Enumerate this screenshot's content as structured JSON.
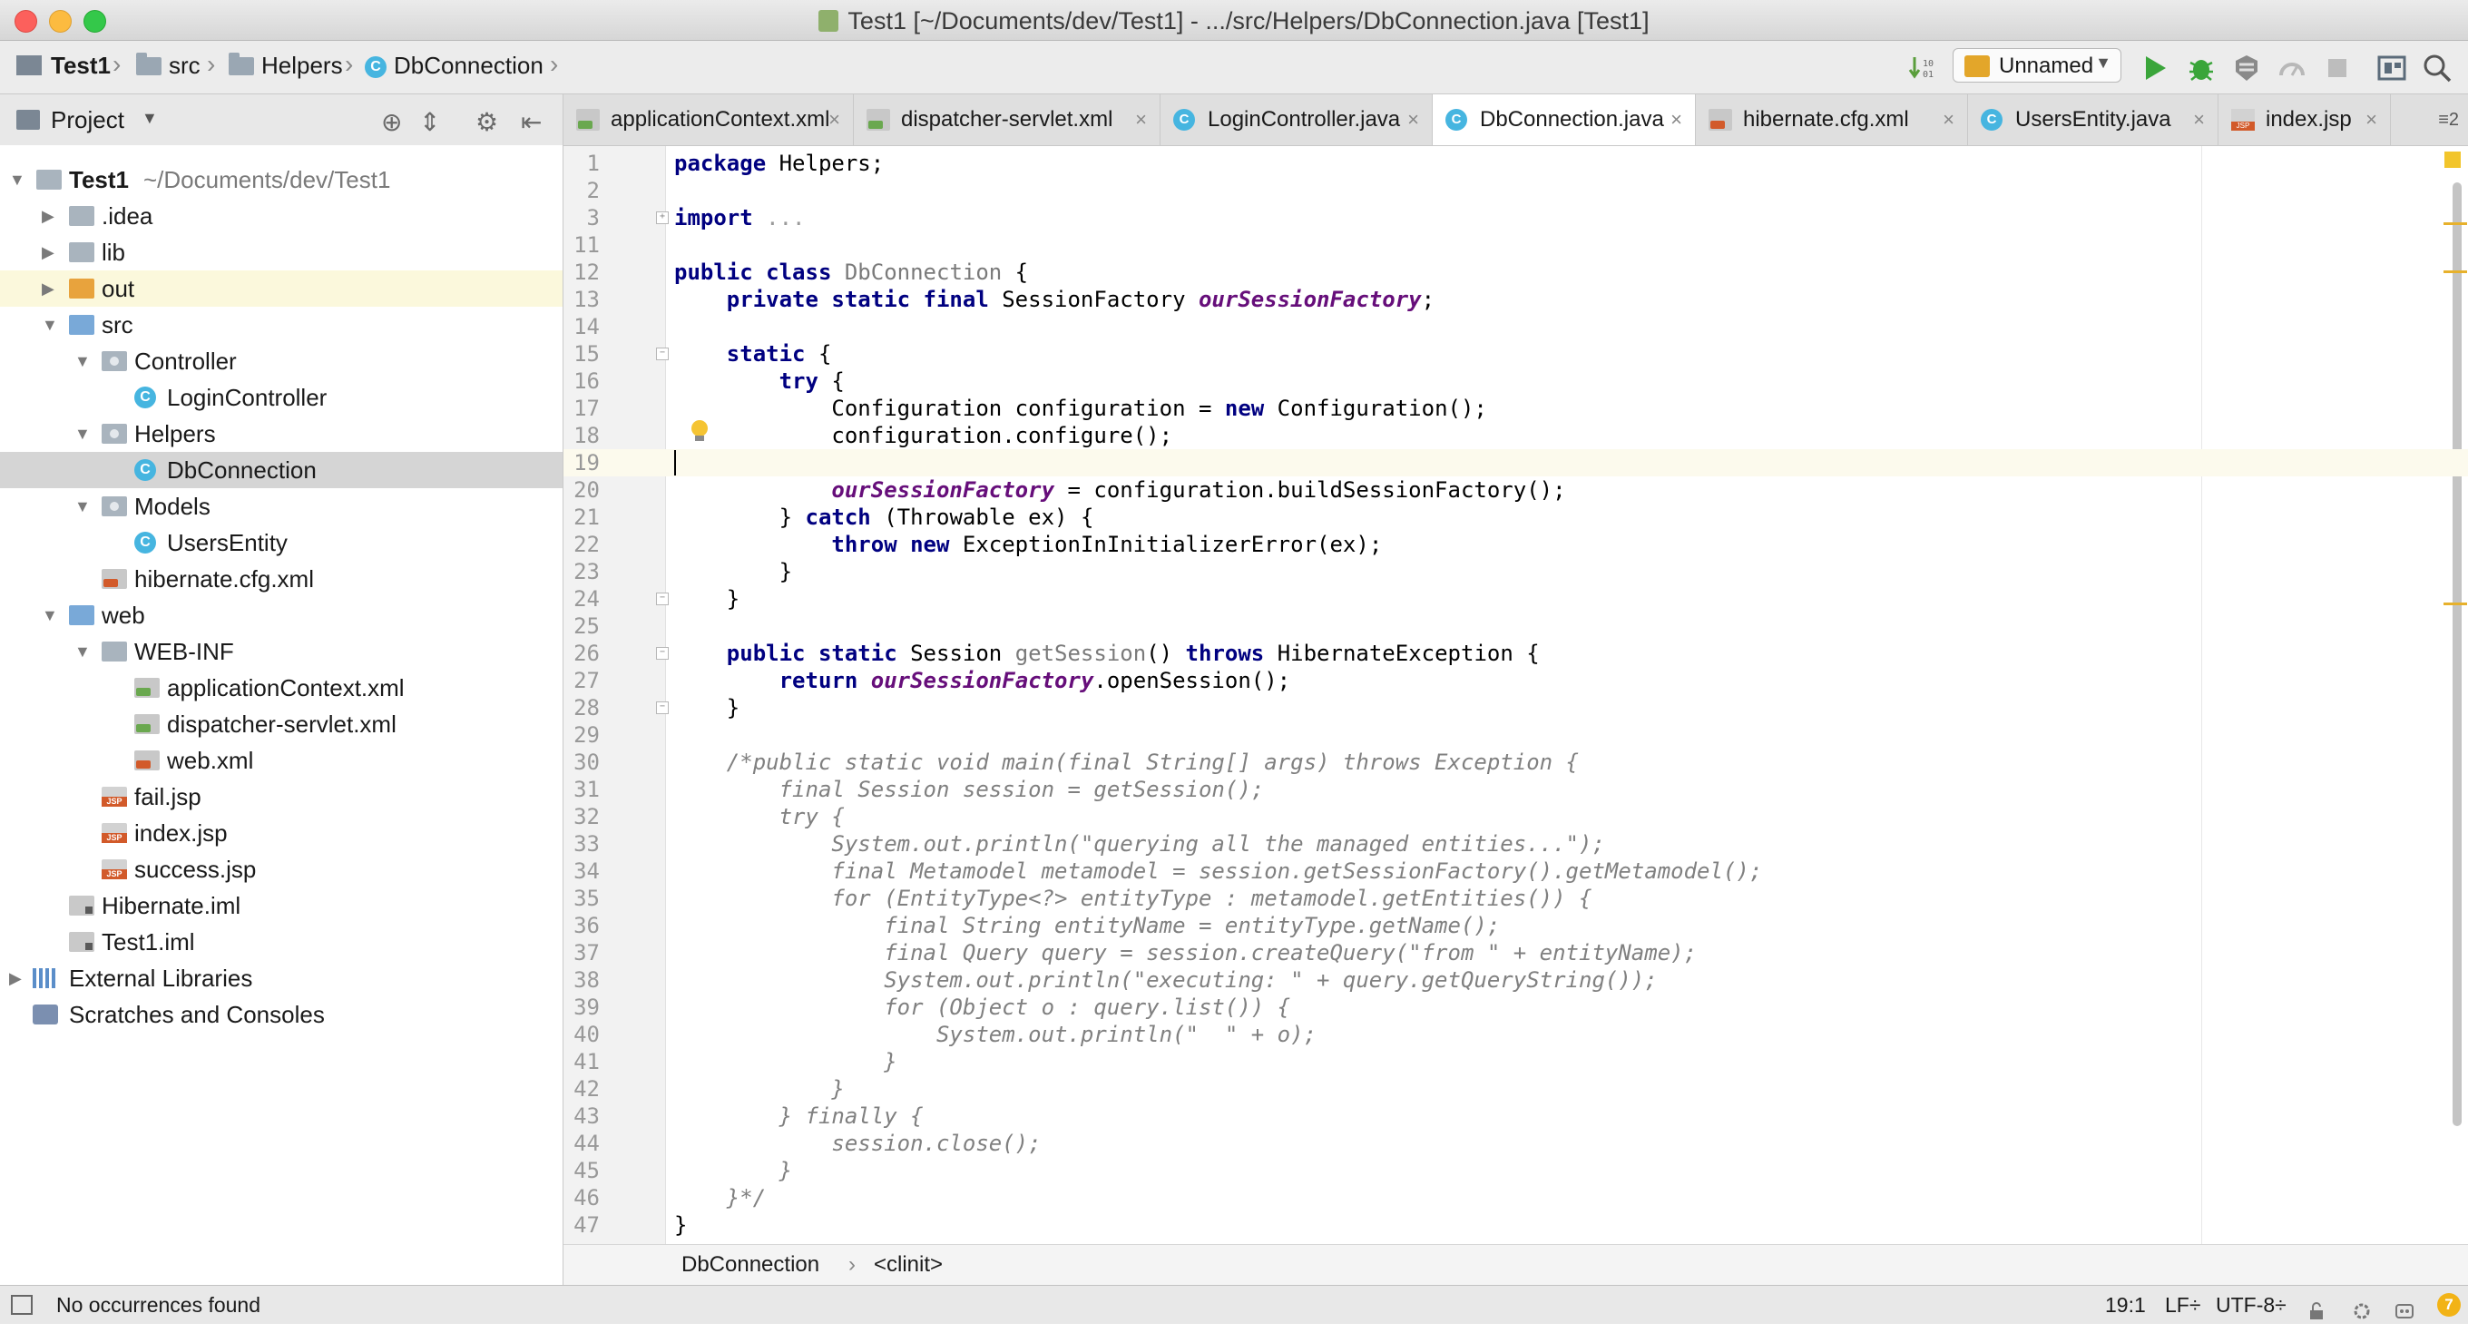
{
  "window": {
    "title": "Test1 [~/Documents/dev/Test1] - .../src/Helpers/DbConnection.java [Test1]"
  },
  "navbar": {
    "breadcrumb": [
      "Test1",
      "src",
      "Helpers",
      "DbConnection"
    ],
    "run_config": "Unnamed"
  },
  "project_panel": {
    "title": "Project",
    "tree": [
      {
        "label": "Test1",
        "hint": "~/Documents/dev/Test1",
        "icon": "project-folder-icon",
        "depth": 0,
        "expanded": true
      },
      {
        "label": ".idea",
        "icon": "folder-icon",
        "depth": 1,
        "expanded": false
      },
      {
        "label": "lib",
        "icon": "folder-icon",
        "depth": 1,
        "expanded": false
      },
      {
        "label": "out",
        "icon": "excluded-folder-icon",
        "depth": 1,
        "expanded": false,
        "excluded": true
      },
      {
        "label": "src",
        "icon": "source-folder-icon",
        "depth": 1,
        "expanded": true
      },
      {
        "label": "Controller",
        "icon": "package-icon",
        "depth": 2,
        "expanded": true
      },
      {
        "label": "LoginController",
        "icon": "java-class-icon",
        "depth": 3
      },
      {
        "label": "Helpers",
        "icon": "package-icon",
        "depth": 2,
        "expanded": true
      },
      {
        "label": "DbConnection",
        "icon": "java-class-icon",
        "depth": 3,
        "selected": true
      },
      {
        "label": "Models",
        "icon": "package-icon",
        "depth": 2,
        "expanded": true
      },
      {
        "label": "UsersEntity",
        "icon": "java-class-icon",
        "depth": 3
      },
      {
        "label": "hibernate.cfg.xml",
        "icon": "xml-file-icon",
        "depth": 2
      },
      {
        "label": "web",
        "icon": "web-folder-icon",
        "depth": 1,
        "expanded": true
      },
      {
        "label": "WEB-INF",
        "icon": "folder-icon",
        "depth": 2,
        "expanded": true
      },
      {
        "label": "applicationContext.xml",
        "icon": "spring-xml-icon",
        "depth": 3
      },
      {
        "label": "dispatcher-servlet.xml",
        "icon": "spring-xml-icon",
        "depth": 3
      },
      {
        "label": "web.xml",
        "icon": "web-xml-icon",
        "depth": 3
      },
      {
        "label": "fail.jsp",
        "icon": "jsp-file-icon",
        "depth": 2
      },
      {
        "label": "index.jsp",
        "icon": "jsp-file-icon",
        "depth": 2
      },
      {
        "label": "success.jsp",
        "icon": "jsp-file-icon",
        "depth": 2
      },
      {
        "label": "Hibernate.iml",
        "icon": "iml-file-icon",
        "depth": 1
      },
      {
        "label": "Test1.iml",
        "icon": "iml-file-icon",
        "depth": 1
      },
      {
        "label": "External Libraries",
        "icon": "libraries-icon",
        "depth": 0,
        "expanded": false
      },
      {
        "label": "Scratches and Consoles",
        "icon": "scratches-icon",
        "depth": 0
      }
    ]
  },
  "tabs": [
    {
      "label": "applicationContext.xml",
      "icon": "spring-xml-icon"
    },
    {
      "label": "dispatcher-servlet.xml",
      "icon": "spring-xml-icon"
    },
    {
      "label": "LoginController.java",
      "icon": "java-class-icon"
    },
    {
      "label": "DbConnection.java",
      "icon": "java-class-icon",
      "active": true
    },
    {
      "label": "hibernate.cfg.xml",
      "icon": "xml-file-icon"
    },
    {
      "label": "UsersEntity.java",
      "icon": "java-class-icon"
    },
    {
      "label": "index.jsp",
      "icon": "jsp-file-icon"
    }
  ],
  "tabs_overflow": "2",
  "editor": {
    "current_line": "19",
    "lines": [
      {
        "n": "1",
        "segs": [
          [
            "kw",
            "package"
          ],
          [
            "p",
            " Helpers;"
          ]
        ]
      },
      {
        "n": "2",
        "segs": []
      },
      {
        "n": "3",
        "segs": [
          [
            "kw",
            "import"
          ],
          [
            "p",
            " "
          ],
          [
            "fold",
            "..."
          ]
        ]
      },
      {
        "n": "11",
        "segs": []
      },
      {
        "n": "12",
        "segs": [
          [
            "kw",
            "public class"
          ],
          [
            "p",
            " "
          ],
          [
            "mname",
            "DbConnection"
          ],
          [
            "p",
            " {"
          ]
        ]
      },
      {
        "n": "13",
        "segs": [
          [
            "p",
            "    "
          ],
          [
            "kw",
            "private static final"
          ],
          [
            "p",
            " SessionFactory "
          ],
          [
            "fld",
            "ourSessionFactory"
          ],
          [
            "p",
            ";"
          ]
        ]
      },
      {
        "n": "14",
        "segs": []
      },
      {
        "n": "15",
        "segs": [
          [
            "p",
            "    "
          ],
          [
            "kw",
            "static"
          ],
          [
            "p",
            " {"
          ]
        ]
      },
      {
        "n": "16",
        "segs": [
          [
            "p",
            "        "
          ],
          [
            "kw",
            "try"
          ],
          [
            "p",
            " {"
          ]
        ]
      },
      {
        "n": "17",
        "segs": [
          [
            "p",
            "            Configuration configuration = "
          ],
          [
            "kw",
            "new"
          ],
          [
            "p",
            " Configuration();"
          ]
        ]
      },
      {
        "n": "18",
        "segs": [
          [
            "p",
            "            configuration.configure();"
          ]
        ]
      },
      {
        "n": "19",
        "segs": []
      },
      {
        "n": "20",
        "segs": [
          [
            "p",
            "            "
          ],
          [
            "fld",
            "ourSessionFactory"
          ],
          [
            "p",
            " = configuration.buildSessionFactory();"
          ]
        ]
      },
      {
        "n": "21",
        "segs": [
          [
            "p",
            "        } "
          ],
          [
            "kw",
            "catch"
          ],
          [
            "p",
            " (Throwable ex) {"
          ]
        ]
      },
      {
        "n": "22",
        "segs": [
          [
            "p",
            "            "
          ],
          [
            "kw",
            "throw new"
          ],
          [
            "p",
            " ExceptionInInitializerError(ex);"
          ]
        ]
      },
      {
        "n": "23",
        "segs": [
          [
            "p",
            "        }"
          ]
        ]
      },
      {
        "n": "24",
        "segs": [
          [
            "p",
            "    }"
          ]
        ]
      },
      {
        "n": "25",
        "segs": []
      },
      {
        "n": "26",
        "segs": [
          [
            "p",
            "    "
          ],
          [
            "kw",
            "public static"
          ],
          [
            "p",
            " Session "
          ],
          [
            "mname",
            "getSession"
          ],
          [
            "p",
            "() "
          ],
          [
            "kw",
            "throws"
          ],
          [
            "p",
            " HibernateException {"
          ]
        ]
      },
      {
        "n": "27",
        "segs": [
          [
            "p",
            "        "
          ],
          [
            "kw",
            "return"
          ],
          [
            "p",
            " "
          ],
          [
            "fld",
            "ourSessionFactory"
          ],
          [
            "p",
            ".openSession();"
          ]
        ]
      },
      {
        "n": "28",
        "segs": [
          [
            "p",
            "    }"
          ]
        ]
      },
      {
        "n": "29",
        "segs": []
      },
      {
        "n": "30",
        "segs": [
          [
            "p",
            "    "
          ],
          [
            "cmt",
            "/*public static void main(final String[] args) throws Exception {"
          ]
        ]
      },
      {
        "n": "31",
        "segs": [
          [
            "cmt",
            "        final Session session = getSession();"
          ]
        ]
      },
      {
        "n": "32",
        "segs": [
          [
            "cmt",
            "        try {"
          ]
        ]
      },
      {
        "n": "33",
        "segs": [
          [
            "cmt",
            "            System.out.println(\"querying all the managed entities...\");"
          ]
        ]
      },
      {
        "n": "34",
        "segs": [
          [
            "cmt",
            "            final Metamodel metamodel = session.getSessionFactory().getMetamodel();"
          ]
        ]
      },
      {
        "n": "35",
        "segs": [
          [
            "cmt",
            "            for (EntityType<?> entityType : metamodel.getEntities()) {"
          ]
        ]
      },
      {
        "n": "36",
        "segs": [
          [
            "cmt",
            "                final String entityName = entityType.getName();"
          ]
        ]
      },
      {
        "n": "37",
        "segs": [
          [
            "cmt",
            "                final Query query = session.createQuery(\"from \" + entityName);"
          ]
        ]
      },
      {
        "n": "38",
        "segs": [
          [
            "cmt",
            "                System.out.println(\"executing: \" + query.getQueryString());"
          ]
        ]
      },
      {
        "n": "39",
        "segs": [
          [
            "cmt",
            "                for (Object o : query.list()) {"
          ]
        ]
      },
      {
        "n": "40",
        "segs": [
          [
            "cmt",
            "                    System.out.println(\"  \" + o);"
          ]
        ]
      },
      {
        "n": "41",
        "segs": [
          [
            "cmt",
            "                }"
          ]
        ]
      },
      {
        "n": "42",
        "segs": [
          [
            "cmt",
            "            }"
          ]
        ]
      },
      {
        "n": "43",
        "segs": [
          [
            "cmt",
            "        } finally {"
          ]
        ]
      },
      {
        "n": "44",
        "segs": [
          [
            "cmt",
            "            session.close();"
          ]
        ]
      },
      {
        "n": "45",
        "segs": [
          [
            "cmt",
            "        }"
          ]
        ]
      },
      {
        "n": "46",
        "segs": [
          [
            "cmt",
            "    }*/"
          ]
        ]
      },
      {
        "n": "47",
        "segs": [
          [
            "p",
            "}"
          ]
        ]
      }
    ]
  },
  "editor_breadcrumb": {
    "class": "DbConnection",
    "member": "<clinit>"
  },
  "status": {
    "message": "No occurrences found",
    "position": "19:1",
    "line_separator": "LF÷",
    "encoding": "UTF-8÷",
    "event_count": "7"
  },
  "colors": {
    "keyword": "#000080",
    "field": "#660e7a",
    "comment": "#808080",
    "current_line": "#fcfaed",
    "selection": "#d5d5d5"
  }
}
